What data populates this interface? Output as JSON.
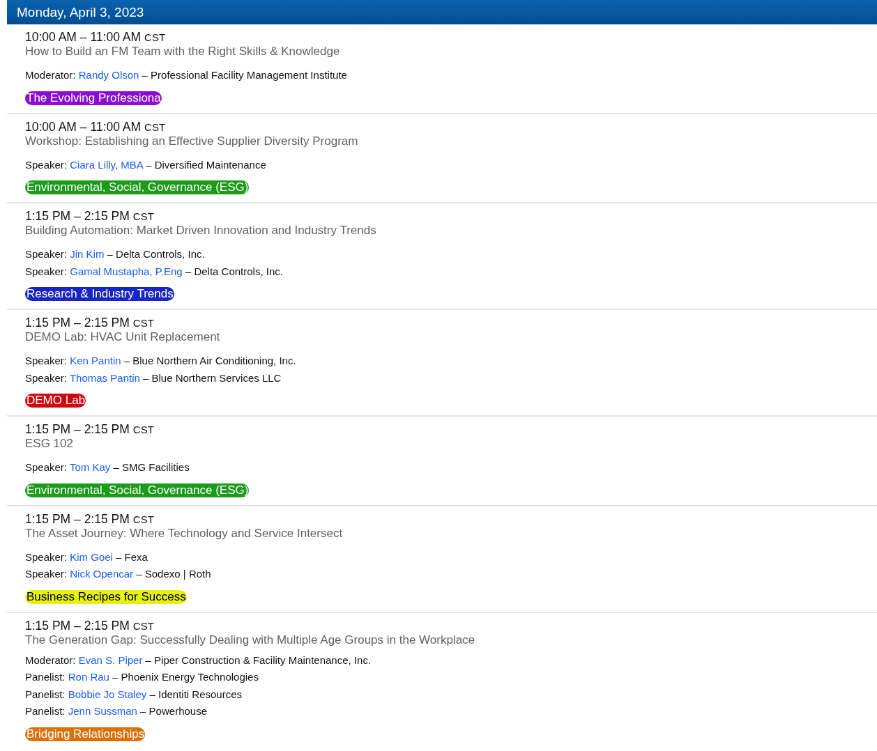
{
  "day": {
    "title": "Monday, April 3, 2023"
  },
  "sessions": [
    {
      "time": "10:00 AM – 11:00 AM",
      "timezone": "CST",
      "title": "How to Build an FM Team with the Right Skills & Knowledge",
      "people": [
        {
          "role": "Moderator:",
          "name": "Randy Olson",
          "org": "– Professional Facility Management Institute"
        }
      ],
      "track": {
        "label": "The Evolving Professiona",
        "color": "#8a0ecf"
      }
    },
    {
      "time": "10:00 AM – 11:00 AM",
      "timezone": "CST",
      "title": "Workshop: Establishing an Effective Supplier Diversity Program",
      "people": [
        {
          "role": "Speaker:",
          "name": "Ciara Lilly, MBA",
          "org": "– Diversified Maintenance"
        }
      ],
      "track": {
        "label": "Environmental, Social, Governance (ESG)",
        "color": "#1c9a1c"
      }
    },
    {
      "time": "1:15 PM – 2:15 PM",
      "timezone": "CST",
      "title": "Building Automation: Market Driven Innovation and Industry Trends",
      "people": [
        {
          "role": "Speaker:",
          "name": "Jin Kim",
          "org": "– Delta Controls, Inc."
        },
        {
          "role": "Speaker:",
          "name": "Gamal Mustapha, P.Eng",
          "org": "– Delta Controls, Inc."
        }
      ],
      "track": {
        "label": "Research & Industry Trends",
        "color": "#1a26c4"
      }
    },
    {
      "time": "1:15 PM – 2:15 PM",
      "timezone": "CST",
      "title": "DEMO Lab: HVAC Unit Replacement",
      "people": [
        {
          "role": "Speaker:",
          "name": "Ken Pantin",
          "org": "– Blue Northern Air Conditioning, Inc."
        },
        {
          "role": "Speaker:",
          "name": "Thomas Pantin",
          "org": "– Blue Northern Services LLC"
        }
      ],
      "track": {
        "label": "DEMO Lab",
        "color": "#d0060f"
      }
    },
    {
      "time": "1:15 PM – 2:15 PM",
      "timezone": "CST",
      "title": "ESG 102",
      "people": [
        {
          "role": "Speaker:",
          "name": "Tom Kay",
          "org": "– SMG Facilities"
        }
      ],
      "track": {
        "label": "Environmental, Social, Governance (ESG)",
        "color": "#1c9a1c"
      }
    },
    {
      "time": "1:15 PM – 2:15 PM",
      "timezone": "CST",
      "title": "The Asset Journey: Where Technology and Service Intersect",
      "people": [
        {
          "role": "Speaker:",
          "name": "Kim Goei",
          "org": "– Fexa"
        },
        {
          "role": "Speaker:",
          "name": "Nick Opencar",
          "org": "– Sodexo | Roth"
        }
      ],
      "track": {
        "label": "Business Recipes for Success",
        "color": "#e6f012"
      }
    },
    {
      "time": "1:15 PM – 2:15 PM",
      "timezone": "CST",
      "title": "The Generation Gap: Successfully Dealing with Multiple Age Groups in the Workplace",
      "people": [
        {
          "role": "Moderator:",
          "name": "Evan S. Piper",
          "org": "– Piper Construction & Facility Maintenance, Inc."
        },
        {
          "role": "Panelist:",
          "name": "Ron Rau",
          "org": "– Phoenix Energy Technologies"
        },
        {
          "role": "Panelist:",
          "name": "Bobbie Jo Staley",
          "org": "– Identiti Resources"
        },
        {
          "role": "Panelist:",
          "name": "Jenn Sussman",
          "org": "– Powerhouse"
        }
      ],
      "track": {
        "label": "Bridging Relationships",
        "color": "#d9700a"
      }
    }
  ]
}
